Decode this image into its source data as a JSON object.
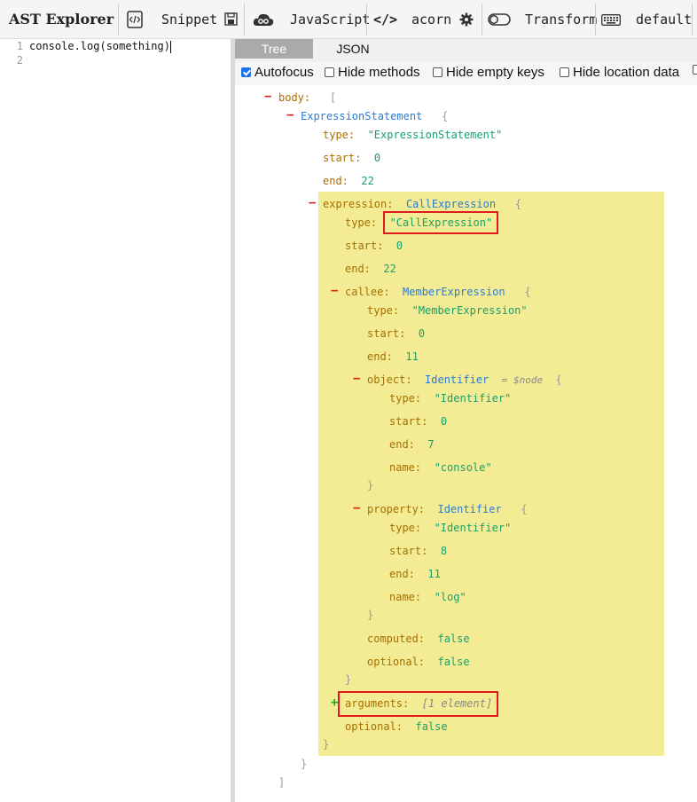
{
  "toolbar": {
    "title": "AST Explorer",
    "snippet": "Snippet",
    "language": "JavaScript",
    "parser": "acorn",
    "transform": "Transform",
    "keymap": "default"
  },
  "editor": {
    "line_numbers": [
      "1",
      "2"
    ],
    "code_line_1": "console.log(something)"
  },
  "output": {
    "tabs": [
      "Tree",
      "JSON"
    ],
    "options": {
      "autofocus": "Autofocus",
      "hide_methods": "Hide methods",
      "hide_empty_keys": "Hide empty keys",
      "hide_location_data": "Hide location data"
    },
    "tree": {
      "body_key": "body:",
      "open_bracket": "[",
      "close_bracket": "]",
      "expr_stmt": "ExpressionStatement",
      "open_brace": "{",
      "close_brace": "}",
      "type_key": "type:",
      "start_key": "start:",
      "end_key": "end:",
      "name_key": "name:",
      "expr_stmt_type": "\"ExpressionStatement\"",
      "expr_stmt_start": "0",
      "expr_stmt_end": "22",
      "expression_key": "expression:",
      "call_expr": "CallExpression",
      "call_expr_type": "\"CallExpression\"",
      "call_start": "0",
      "call_end": "22",
      "callee_key": "callee:",
      "member_expr": "MemberExpression",
      "member_type": "\"MemberExpression\"",
      "member_start": "0",
      "member_end": "11",
      "object_key": "object:",
      "identifier": "Identifier",
      "node_marker": "= $node",
      "identifier_type": "\"Identifier\"",
      "obj_start": "0",
      "obj_end": "7",
      "obj_name": "\"console\"",
      "property_key": "property:",
      "prop_start": "8",
      "prop_end": "11",
      "prop_name": "\"log\"",
      "computed_key": "computed:",
      "computed_val": "false",
      "optional_key": "optional:",
      "optional_val": "false",
      "arguments_key": "arguments:",
      "arguments_summary": "[1 element]",
      "call_optional_val": "false"
    }
  }
}
